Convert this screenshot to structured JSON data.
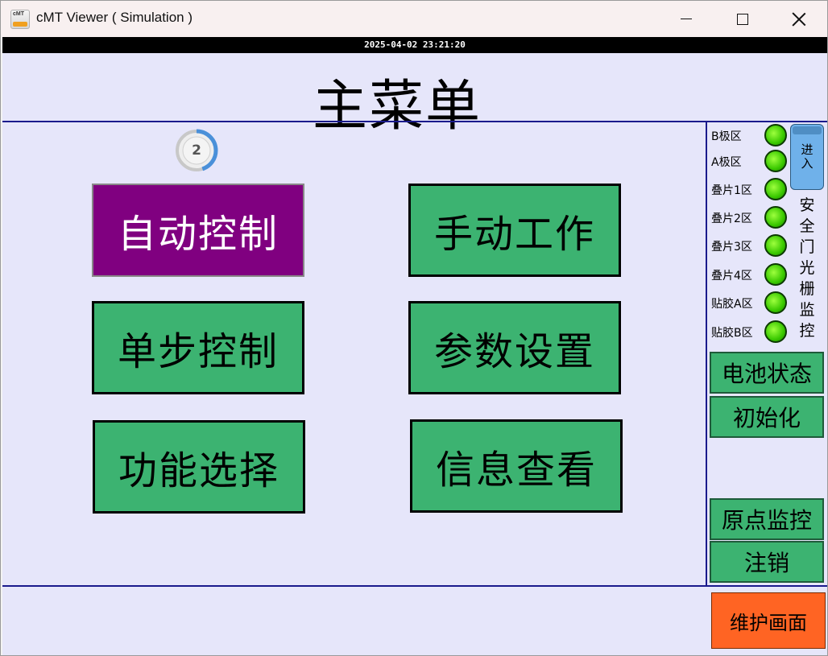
{
  "window": {
    "title": "cMT Viewer ( Simulation )",
    "icon_text": "cMT"
  },
  "datetime": "2025-04-02 23:21:20",
  "page": {
    "title": "主菜单"
  },
  "progress": {
    "value": "2",
    "fraction": 0.45,
    "color": "#4a90d9"
  },
  "menu": {
    "buttons": [
      {
        "label": "自动控制",
        "active": true
      },
      {
        "label": "手动工作",
        "active": false
      },
      {
        "label": "单步控制",
        "active": false
      },
      {
        "label": "参数设置",
        "active": false
      },
      {
        "label": "功能选择",
        "active": false
      },
      {
        "label": "信息查看",
        "active": false
      }
    ]
  },
  "monitor": {
    "zones": [
      {
        "label": "B极区",
        "state": "on"
      },
      {
        "label": "A极区",
        "state": "on"
      },
      {
        "label": "叠片1区",
        "state": "on"
      },
      {
        "label": "叠片2区",
        "state": "on"
      },
      {
        "label": "叠片3区",
        "state": "on"
      },
      {
        "label": "叠片4区",
        "state": "on"
      },
      {
        "label": "贴胶A区",
        "state": "on"
      },
      {
        "label": "贴胶B区",
        "state": "on"
      }
    ],
    "enter_label_1": "进",
    "enter_label_2": "入",
    "door_label": "安全门光栅监控"
  },
  "side": {
    "battery": "电池状态",
    "init": "初始化",
    "origin": "原点监控",
    "logout": "注销",
    "maintenance": "维护画面"
  },
  "colors": {
    "screen_bg": "#e6e6fa",
    "button_green": "#3cb371",
    "button_active": "#800080",
    "maintenance": "#ff6423",
    "divider": "#1a1a8c",
    "led_on": "#39c800"
  }
}
